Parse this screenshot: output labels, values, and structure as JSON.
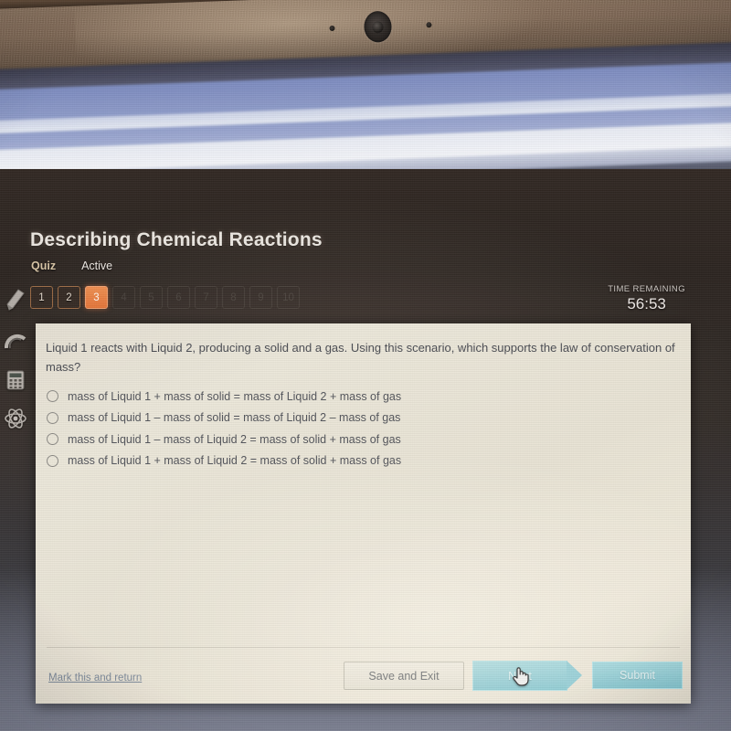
{
  "device": {
    "webcam_icon": "webcam-lens",
    "sensor_left_icon": "sensor-dot",
    "sensor_right_icon": "sensor-dot"
  },
  "tools": [
    {
      "icon": "highlighter-pencil-icon"
    },
    {
      "icon": "protractor-icon"
    },
    {
      "icon": "calculator-icon"
    },
    {
      "icon": "atom-molecule-icon"
    }
  ],
  "header": {
    "title": "Describing Chemical Reactions",
    "quiz_label": "Quiz",
    "status_label": "Active"
  },
  "question_nav": {
    "items": [
      {
        "number": "1",
        "state": "done"
      },
      {
        "number": "2",
        "state": "done"
      },
      {
        "number": "3",
        "state": "current"
      },
      {
        "number": "4",
        "state": "locked"
      },
      {
        "number": "5",
        "state": "locked"
      },
      {
        "number": "6",
        "state": "locked"
      },
      {
        "number": "7",
        "state": "locked"
      },
      {
        "number": "8",
        "state": "locked"
      },
      {
        "number": "9",
        "state": "locked"
      },
      {
        "number": "10",
        "state": "locked"
      }
    ]
  },
  "timer": {
    "label": "TIME REMAINING",
    "value": "56:53"
  },
  "question": {
    "text": "Liquid 1 reacts with Liquid 2, producing a solid and a gas. Using this scenario, which supports the law of conservation of mass?",
    "options": [
      {
        "label": "mass of Liquid 1 + mass of solid = mass of Liquid 2 + mass of gas",
        "selected": false
      },
      {
        "label": "mass of Liquid 1 – mass of solid = mass of Liquid 2 – mass of gas",
        "selected": false
      },
      {
        "label": "mass of Liquid 1 – mass of Liquid 2 = mass of solid + mass of gas",
        "selected": false
      },
      {
        "label": "mass of Liquid 1 + mass of Liquid 2 = mass of solid + mass of gas",
        "selected": false
      }
    ]
  },
  "footer": {
    "mark_link": "Mark this and return",
    "save_label": "Save and Exit",
    "next_label": "Next",
    "submit_label": "Submit"
  },
  "cursor": {
    "icon": "hand-pointer-cursor"
  },
  "colors": {
    "accent_orange": "#e4763a",
    "button_teal": "#7cc3cf",
    "card_bg": "#e9e3d5",
    "page_bg": "#2c2521",
    "link_blue": "#7d8a9a"
  }
}
